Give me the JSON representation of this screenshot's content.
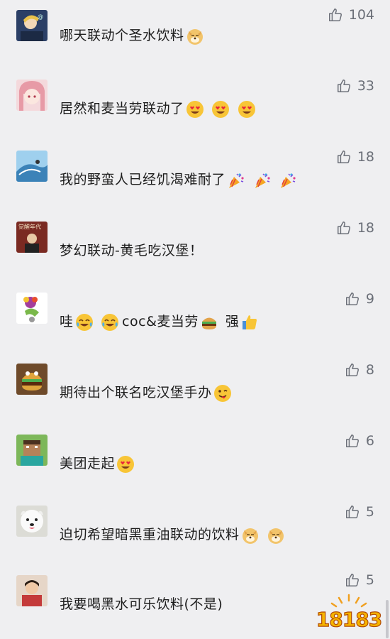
{
  "comments": [
    {
      "avatar": "anime-boy-avatar",
      "text": "哪天联动个圣水饮料",
      "emojis": [
        "doge"
      ],
      "likes": "104"
    },
    {
      "avatar": "pink-hair-girl-avatar",
      "text": "居然和麦当劳联动了",
      "emojis": [
        "heart-eyes",
        "heart-eyes",
        "heart-eyes"
      ],
      "likes": "33"
    },
    {
      "avatar": "wave-surfer-avatar",
      "text": "我的野蛮人已经饥渴难耐了",
      "emojis": [
        "party-popper",
        "party-popper",
        "party-popper"
      ],
      "likes": "18"
    },
    {
      "avatar": "jueying-niandai-avatar",
      "avatar_label": "觉醒年代",
      "text": "梦幻联动-黄毛吃汉堡！",
      "emojis": [],
      "likes": "18"
    },
    {
      "avatar": "cartoon-character-avatar",
      "text": "哇",
      "text2": "coc&麦当劳",
      "text3": "强",
      "emojis": [
        "laugh-cry",
        "laugh-cry"
      ],
      "likes": "9"
    },
    {
      "avatar": "burger-toy-avatar",
      "text": "期待出个联名吃汉堡手办",
      "emojis": [
        "wink-tongue"
      ],
      "likes": "8"
    },
    {
      "avatar": "minecraft-steve-avatar",
      "text": "美团走起",
      "emojis": [
        "heart-eyes"
      ],
      "likes": "6"
    },
    {
      "avatar": "white-dog-avatar",
      "text": "迫切希望暗黑重油联动的饮料",
      "emojis": [
        "doge",
        "doge"
      ],
      "likes": "5"
    },
    {
      "avatar": "child-photo-avatar",
      "text": "我要喝黑水可乐饮料(不是)",
      "emojis": [],
      "likes": "5"
    }
  ],
  "watermark": "18183",
  "icons": {
    "like": "thumbs-up-icon"
  }
}
